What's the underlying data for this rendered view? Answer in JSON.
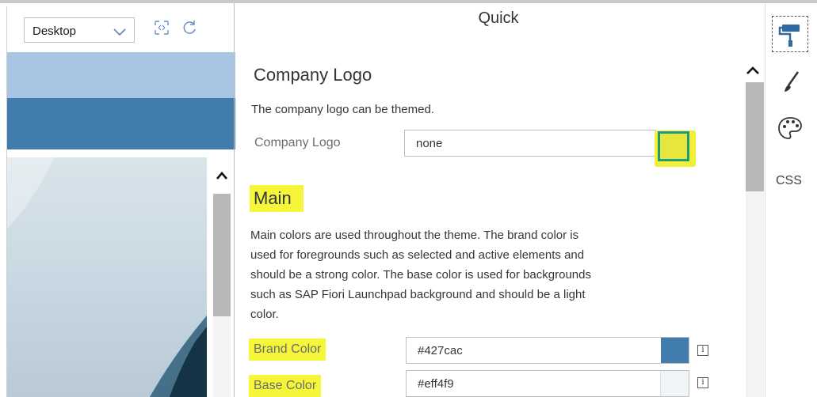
{
  "preview": {
    "device_select_value": "Desktop",
    "toolbar_icons": [
      "fit-to-screen-icon",
      "refresh-icon"
    ]
  },
  "panel": {
    "title": "Quick",
    "company_logo_section": {
      "title": "Company Logo",
      "description": "The company logo can be themed.",
      "field_label": "Company Logo",
      "field_value": "none"
    },
    "main_section": {
      "title": "Main",
      "description_lines": [
        "Main colors are used throughout the theme. The brand color is",
        "used for foregrounds such as selected and active elements and",
        "should be a strong color. The base color is used for backgrounds",
        "such as SAP Fiori Launchpad background and should be a light",
        "color."
      ],
      "brand_color": {
        "label": "Brand Color",
        "value": "#427cac",
        "swatch": "#427cac"
      },
      "base_color": {
        "label": "Base Color",
        "value": "#eff4f9",
        "swatch": "#eff4f9"
      }
    }
  },
  "tools": {
    "items": [
      "paint-roller-icon",
      "brush-icon",
      "palette-icon"
    ],
    "css_label": "CSS"
  },
  "colors": {
    "highlight": "#f5f53a",
    "brand": "#427cac",
    "shell_light": "#a8c6e3"
  }
}
